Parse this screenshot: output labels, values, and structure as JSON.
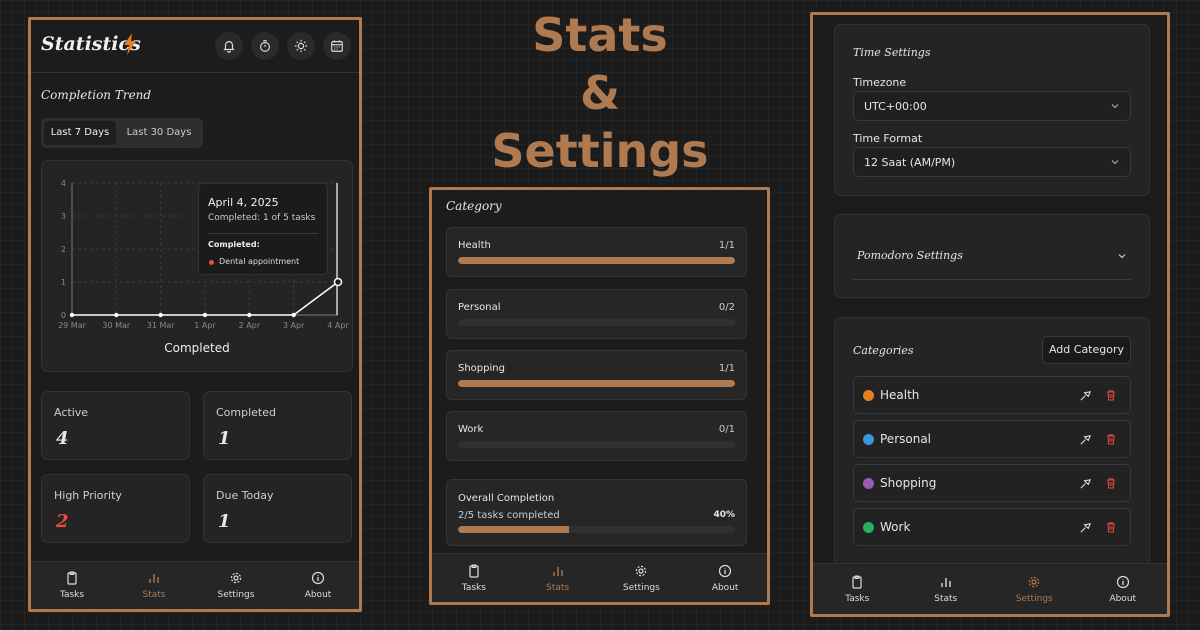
{
  "headline": {
    "line1": "Stats",
    "line2": "&",
    "line3": "Settings"
  },
  "colors": {
    "accent": "#b07a50",
    "health": "#e67e22",
    "personal": "#3498db",
    "shopping": "#9b59b6",
    "work": "#27ae60",
    "danger": "#e74c3c"
  },
  "nav": {
    "tasks": "Tasks",
    "stats": "Stats",
    "settings": "Settings",
    "about": "About",
    "icons": [
      "clipboard-icon",
      "bar-chart-icon",
      "gear-icon",
      "info-icon"
    ]
  },
  "stats_screen": {
    "title": "Statistics",
    "header_icons": [
      "bell-icon",
      "timer-icon",
      "sun-icon",
      "calendar-icon"
    ],
    "trend_title": "Completion Trend",
    "range_tabs": [
      "Last 7 Days",
      "Last 30 Days"
    ],
    "tooltip": {
      "date": "April 4, 2025",
      "summary": "Completed: 1 of 5 tasks",
      "heading": "Completed:",
      "item": "Dental appointment"
    },
    "cards": {
      "active_label": "Active",
      "active_value": "4",
      "completed_label": "Completed",
      "completed_value": "1",
      "high_label": "High Priority",
      "high_value": "2",
      "due_label": "Due Today",
      "due_value": "1"
    }
  },
  "chart_data": {
    "type": "line",
    "x": [
      "29 Mar",
      "30 Mar",
      "31 Mar",
      "1 Apr",
      "2 Apr",
      "3 Apr",
      "4 Apr"
    ],
    "series": [
      {
        "name": "Completed",
        "values": [
          0,
          0,
          0,
          0,
          0,
          0,
          1
        ]
      }
    ],
    "yticks": [
      "0",
      "1",
      "2",
      "3",
      "4"
    ],
    "ylim": [
      0,
      4
    ],
    "legend": "Completed",
    "grid": true
  },
  "category_screen": {
    "title": "Category",
    "items": [
      {
        "name": "Health",
        "count": "1/1",
        "progress": 1.0
      },
      {
        "name": "Personal",
        "count": "0/2",
        "progress": 0.0
      },
      {
        "name": "Shopping",
        "count": "1/1",
        "progress": 1.0
      },
      {
        "name": "Work",
        "count": "0/1",
        "progress": 0.0
      }
    ],
    "overall": {
      "title": "Overall Completion",
      "subtitle": "2/5 tasks completed",
      "percent": "40%",
      "progress": 0.4
    }
  },
  "settings_screen": {
    "time_title": "Time Settings",
    "timezone_label": "Timezone",
    "timezone_value": "UTC+00:00",
    "format_label": "Time Format",
    "format_value": "12 Saat (AM/PM)",
    "pomodoro_title": "Pomodoro Settings",
    "categories_title": "Categories",
    "add_category": "Add Category",
    "categories": [
      {
        "name": "Health",
        "color": "#e67e22"
      },
      {
        "name": "Personal",
        "color": "#3498db"
      },
      {
        "name": "Shopping",
        "color": "#9b59b6"
      },
      {
        "name": "Work",
        "color": "#27ae60"
      }
    ]
  }
}
